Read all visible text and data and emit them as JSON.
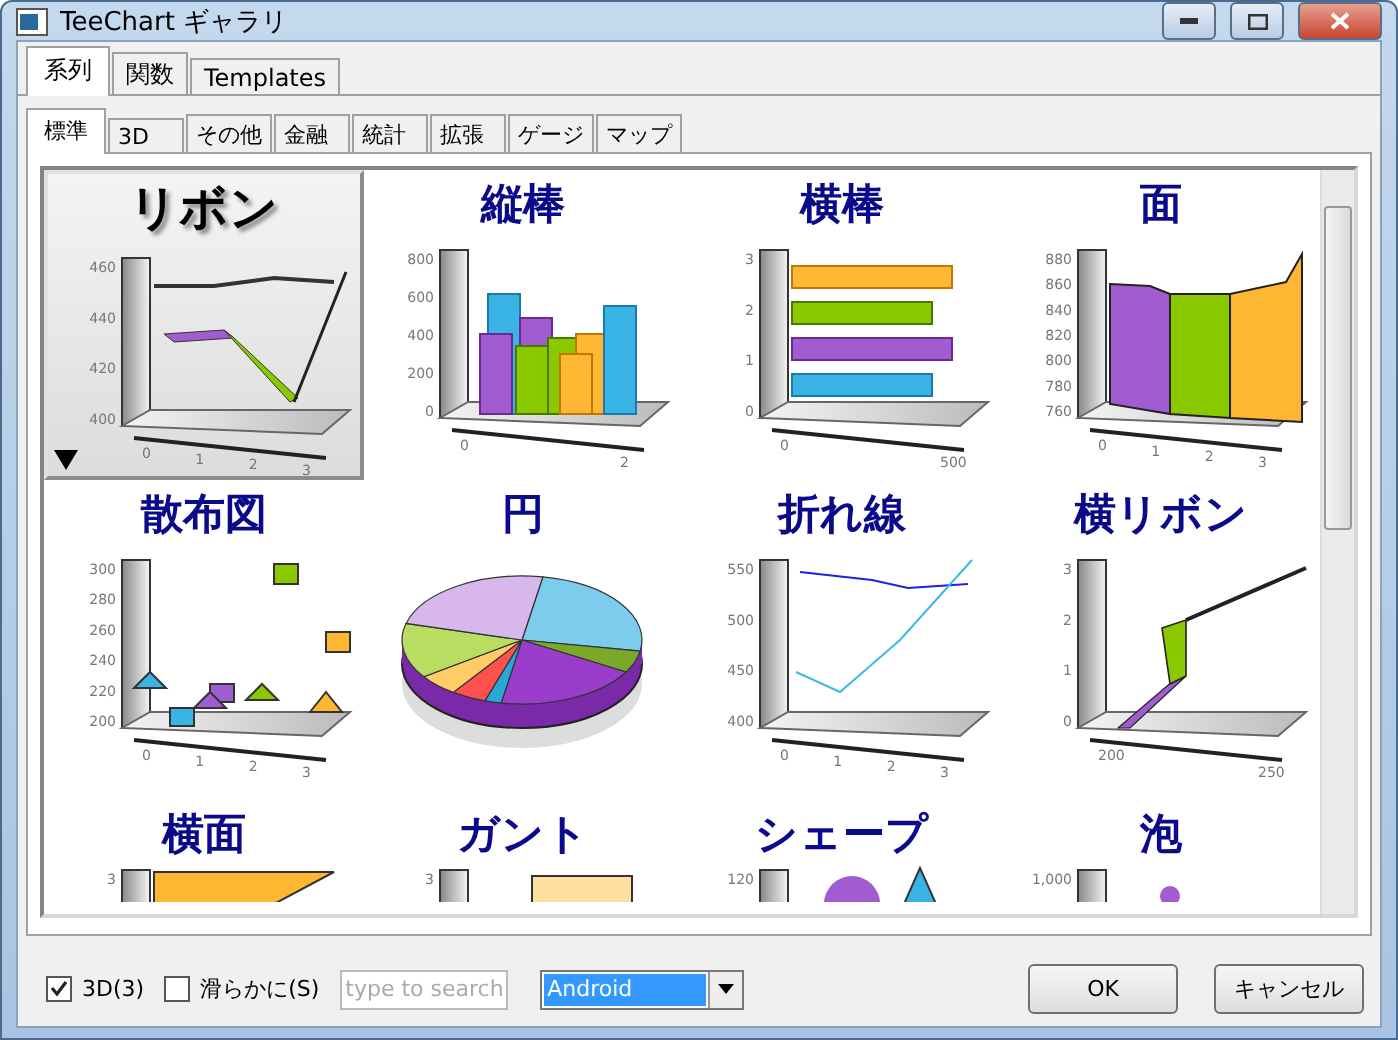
{
  "window": {
    "title": "TeeChart ギャラリ"
  },
  "tabs": [
    {
      "label": "系列",
      "selected": true
    },
    {
      "label": "関数",
      "selected": false
    },
    {
      "label": "Templates",
      "selected": false
    }
  ],
  "subtabs": [
    {
      "label": "標準",
      "selected": true
    },
    {
      "label": "3D",
      "selected": false
    },
    {
      "label": "その他",
      "selected": false
    },
    {
      "label": "金融",
      "selected": false
    },
    {
      "label": "統計",
      "selected": false
    },
    {
      "label": "拡張",
      "selected": false
    },
    {
      "label": "ゲージ",
      "selected": false
    },
    {
      "label": "マップ",
      "selected": false
    }
  ],
  "gallery": [
    {
      "title": "リボン",
      "kind": "ribbon",
      "selected": true,
      "yticks": [
        "460",
        "440",
        "420",
        "400"
      ],
      "xticks": [
        "0",
        "1",
        "2",
        "3"
      ]
    },
    {
      "title": "縦棒",
      "kind": "bar",
      "selected": false,
      "yticks": [
        "800",
        "600",
        "400",
        "200",
        "0"
      ],
      "xticks": [
        "0",
        "2"
      ]
    },
    {
      "title": "横棒",
      "kind": "hbar",
      "selected": false,
      "yticks": [
        "3",
        "2",
        "1",
        "0"
      ],
      "xticks": [
        "0",
        "500"
      ]
    },
    {
      "title": "面",
      "kind": "area",
      "selected": false,
      "yticks": [
        "880",
        "860",
        "840",
        "820",
        "800",
        "780",
        "760"
      ],
      "xticks": [
        "0",
        "1",
        "2",
        "3"
      ]
    },
    {
      "title": "散布図",
      "kind": "scatter",
      "selected": false,
      "yticks": [
        "300",
        "280",
        "260",
        "240",
        "220",
        "200"
      ],
      "xticks": [
        "0",
        "1",
        "2",
        "3"
      ]
    },
    {
      "title": "円",
      "kind": "pie",
      "selected": false
    },
    {
      "title": "折れ線",
      "kind": "line",
      "selected": false,
      "yticks": [
        "550",
        "500",
        "450",
        "400"
      ],
      "xticks": [
        "0",
        "1",
        "2",
        "3"
      ]
    },
    {
      "title": "横リボン",
      "kind": "hribbon",
      "selected": false,
      "yticks": [
        "3",
        "2",
        "1",
        "0"
      ],
      "xticks": [
        "200",
        "250"
      ]
    },
    {
      "title": "横面",
      "kind": "harea",
      "selected": false,
      "yticks": [
        "3"
      ]
    },
    {
      "title": "ガント",
      "kind": "gantt",
      "selected": false,
      "yticks": [
        "3"
      ]
    },
    {
      "title": "シェープ",
      "kind": "shape",
      "selected": false,
      "yticks": [
        "120"
      ]
    },
    {
      "title": "泡",
      "kind": "bubble",
      "selected": false,
      "yticks": [
        "1,000"
      ]
    }
  ],
  "options": [
    {
      "label": "3D(3)",
      "checked": true
    },
    {
      "label": "滑らかに(S)",
      "checked": false
    }
  ],
  "search": {
    "placeholder": "type to search"
  },
  "theme_select": {
    "value": "Android"
  },
  "buttons": [
    "OK",
    "キャンセル"
  ]
}
